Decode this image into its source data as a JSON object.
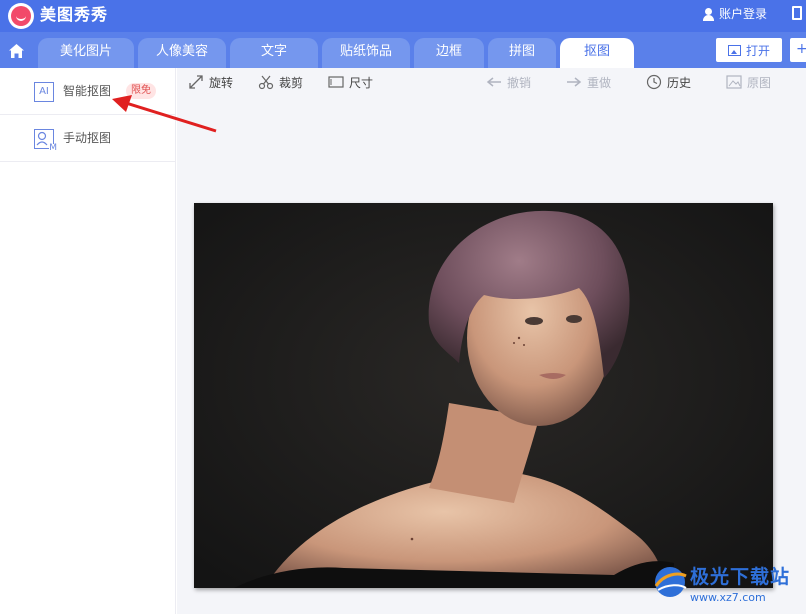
{
  "app": {
    "title": "美图秀秀",
    "login_label": "账户登录"
  },
  "tabs": [
    {
      "label": "美化图片"
    },
    {
      "label": "人像美容"
    },
    {
      "label": "文字"
    },
    {
      "label": "贴纸饰品"
    },
    {
      "label": "边框"
    },
    {
      "label": "拼图"
    },
    {
      "label": "抠图",
      "active": true
    }
  ],
  "header_buttons": {
    "open_label": "打开",
    "add_label": "+"
  },
  "sidebar": {
    "items": [
      {
        "icon_text": "AI",
        "label": "智能抠图",
        "badge": "限免"
      },
      {
        "icon_text": "M",
        "label": "手动抠图"
      }
    ]
  },
  "toolbar": {
    "rotate": "旋转",
    "crop": "裁剪",
    "size": "尺寸",
    "undo": "撤销",
    "redo": "重做",
    "history": "历史",
    "original": "原图"
  },
  "watermark": {
    "main": "极光下载站",
    "sub": "www.xz7.com"
  },
  "colors": {
    "brand": "#4a72e8",
    "tab_bar": "#5a80ea",
    "arrow": "#e02020"
  },
  "icons": [
    "home-icon",
    "user-icon",
    "open-icon",
    "rotate-icon",
    "scissors-icon",
    "size-icon",
    "undo-icon",
    "redo-icon",
    "clock-icon",
    "image-icon"
  ]
}
